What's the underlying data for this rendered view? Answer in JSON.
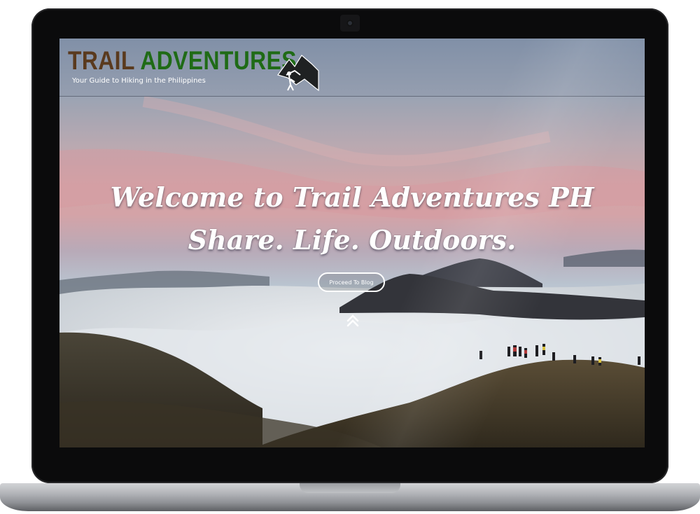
{
  "site": {
    "logo": {
      "word1": "TRAIL",
      "word2": "ADVENTURES",
      "tagline": "Your Guide to Hiking in the Philippines",
      "mark_icon": "hiker-mountain-icon"
    },
    "hero": {
      "line1": "Welcome to Trail Adventures PH",
      "line2": "Share. Life. Outdoors.",
      "cta_label": "Proceed To Blog",
      "scroll_icon": "double-chevron-up-icon"
    }
  },
  "colors": {
    "logo_brown": "#5a3a1e",
    "logo_green": "#1f6b16",
    "hero_text": "#ffffff",
    "laptop_bezel": "#0b0b0c"
  }
}
